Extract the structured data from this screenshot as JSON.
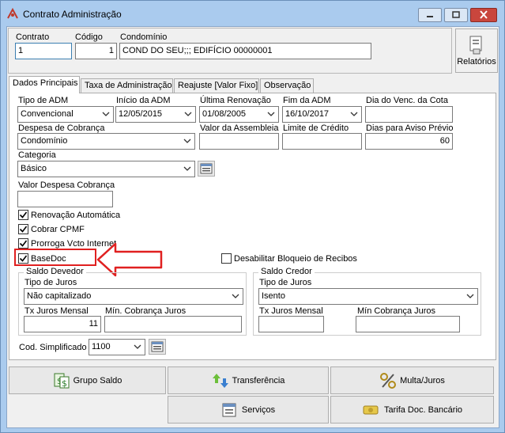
{
  "window": {
    "title": "Contrato Administração"
  },
  "header": {
    "contrato_label": "Contrato",
    "contrato_value": "1",
    "codigo_label": "Código",
    "codigo_value": "1",
    "condominio_label": "Condomínio",
    "condominio_value": "COND DO SEU;;; EDIFÍCIO 00000001",
    "relatorios_label": "Relatórios"
  },
  "tabs": [
    {
      "label": "Dados Principais"
    },
    {
      "label": "Taxa de Administração"
    },
    {
      "label": "Reajuste [Valor Fixo]"
    },
    {
      "label": "Observação"
    }
  ],
  "form": {
    "tipo_adm_label": "Tipo de ADM",
    "tipo_adm_value": "Convencional",
    "inicio_adm_label": "Início da ADM",
    "inicio_adm_value": "12/05/2015",
    "ultima_renovacao_label": "Última Renovação",
    "ultima_renovacao_value": "01/08/2005",
    "fim_adm_label": "Fim da ADM",
    "fim_adm_value": "16/10/2017",
    "dia_venc_label": "Dia do Venc. da Cota",
    "dia_venc_value": "",
    "despesa_cobranca_label": "Despesa de Cobrança",
    "despesa_cobranca_value": "Condomínio",
    "valor_assembleia_label": "Valor da Assembleia",
    "valor_assembleia_value": "",
    "limite_credito_label": "Limite de Crédito",
    "limite_credito_value": "",
    "dias_aviso_label": "Dias para Aviso Prévio",
    "dias_aviso_value": "60",
    "categoria_label": "Categoria",
    "categoria_value": "Básico",
    "valor_despesa_label": "Valor Despesa Cobrança",
    "valor_despesa_value": "",
    "renovacao_auto_label": "Renovação Automática",
    "cobrar_cpmf_label": "Cobrar CPMF",
    "prorroga_label": "Prorroga Vcto Internet",
    "basedoc_label": "BaseDoc",
    "desabilitar_label": "Desabilitar Bloqueio de Recibos",
    "cod_simplificado_label": "Cod. Simplificado",
    "cod_simplificado_value": "1100"
  },
  "saldo_devedor": {
    "title": "Saldo Devedor",
    "tipo_juros_label": "Tipo de Juros",
    "tipo_juros_value": "Não capitalizado",
    "tx_juros_label": "Tx Juros Mensal",
    "tx_juros_value": "11",
    "min_cobranca_label": "Mín. Cobrança Juros",
    "min_cobranca_value": ""
  },
  "saldo_credor": {
    "title": "Saldo Credor",
    "tipo_juros_label": "Tipo de Juros",
    "tipo_juros_value": "Isento",
    "tx_juros_label": "Tx Juros Mensal",
    "tx_juros_value": "",
    "min_cobranca_label": "Mín Cobrança Juros",
    "min_cobranca_value": ""
  },
  "buttons": {
    "grupo_saldo": "Grupo Saldo",
    "transferencia": "Transferência",
    "multa_juros": "Multa/Juros",
    "servicos": "Serviços",
    "tarifa_doc": "Tarifa Doc. Bancário"
  },
  "colors": {
    "titlebar": "#aacbee",
    "annotation_red": "#e02020"
  },
  "icons": [
    "app-icon",
    "minimize-icon",
    "maximize-icon",
    "close-icon",
    "report-icon",
    "chevron-down-icon",
    "checkmark-icon",
    "search-list-icon",
    "money-icon",
    "transfer-arrows-icon",
    "percent-icon",
    "services-icon",
    "money-bill-icon",
    "red-arrow-annotation"
  ]
}
